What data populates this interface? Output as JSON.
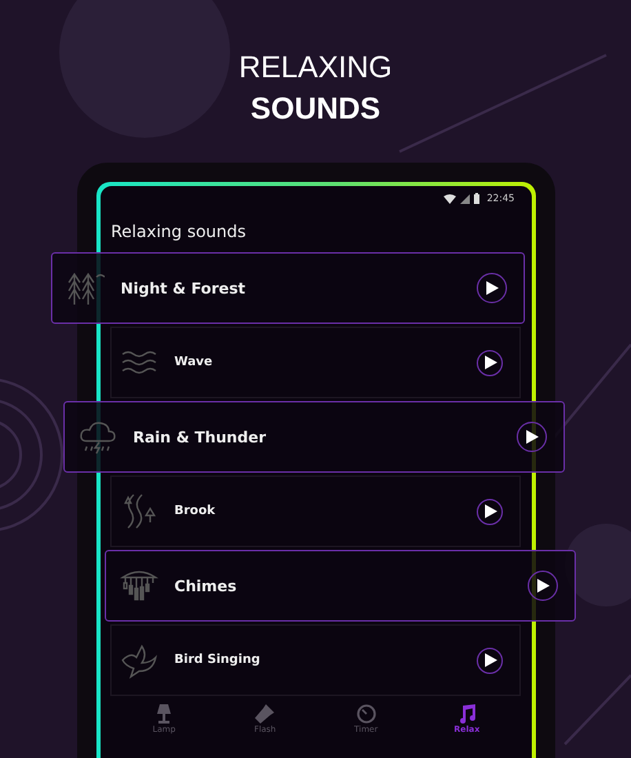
{
  "headline": {
    "line_1": "RELAXING",
    "line_2": "SOUNDS"
  },
  "status_bar": {
    "time": "22:45"
  },
  "screen_title": "Relaxing sounds",
  "sounds": [
    {
      "name": "Night & Forest",
      "kind": "forest",
      "expanded": true
    },
    {
      "name": "Wave",
      "kind": "wave",
      "expanded": false
    },
    {
      "name": "Rain & Thunder",
      "kind": "rain",
      "expanded": true
    },
    {
      "name": "Brook",
      "kind": "brook",
      "expanded": false
    },
    {
      "name": "Chimes",
      "kind": "chimes",
      "expanded": true
    },
    {
      "name": "Bird Singing",
      "kind": "bird",
      "expanded": false
    }
  ],
  "nav": [
    {
      "label": "Lamp",
      "kind": "lamp",
      "selected": false
    },
    {
      "label": "Flash",
      "kind": "flash",
      "selected": false
    },
    {
      "label": "Timer",
      "kind": "timer",
      "selected": false
    },
    {
      "label": "Relax",
      "kind": "music",
      "selected": true
    }
  ]
}
